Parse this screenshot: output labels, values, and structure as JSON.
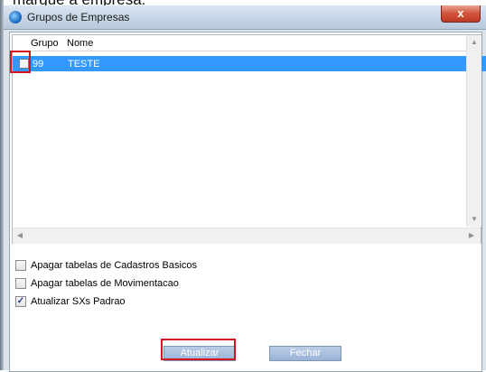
{
  "caption": "marque a empresa:",
  "window": {
    "title": "Grupos de Empresas",
    "close_glyph": "x"
  },
  "grid": {
    "columns": [
      "Grupo",
      "Nome"
    ],
    "rows": [
      {
        "checked": false,
        "grupo": "99",
        "nome": "TESTE",
        "selected": true
      }
    ],
    "scroll_up_glyph": "▲",
    "scroll_down_glyph": "▼",
    "scroll_left_glyph": "◀",
    "scroll_right_glyph": "▶"
  },
  "options": [
    {
      "label": "Apagar tabelas de Cadastros Basicos",
      "checked": false
    },
    {
      "label": "Apagar tabelas de Movimentacao",
      "checked": false
    },
    {
      "label": "Atualizar SXs Padrao",
      "checked": true
    }
  ],
  "buttons": {
    "update_label": "Atualizar",
    "close_label": "Fechar"
  },
  "colors": {
    "selection": "#3399ff",
    "highlight_box": "#d4141e",
    "button": "#9ab3d6"
  },
  "icons": {
    "app": "protheus-app-icon",
    "close": "close-icon",
    "check": "check-icon"
  }
}
